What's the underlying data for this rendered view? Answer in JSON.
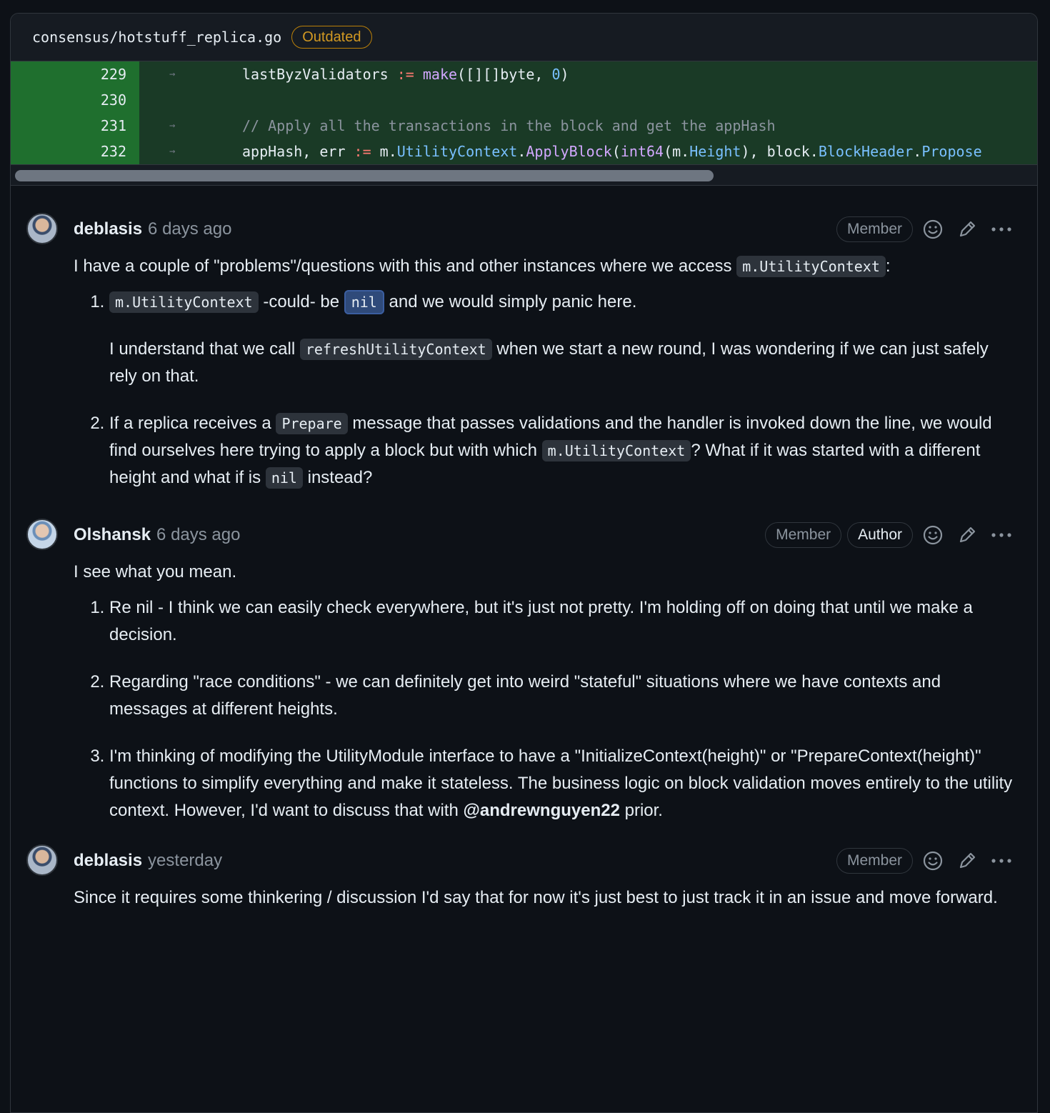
{
  "file": {
    "path": "consensus/hotstuff_replica.go",
    "badge": "Outdated"
  },
  "code_lines": [
    {
      "num": "229",
      "a": "lastByzValidators",
      "b": " := ",
      "c": "make",
      "d": "([][]byte, ",
      "e": "0",
      "f": ")"
    },
    {
      "num": "230"
    },
    {
      "num": "231",
      "comment": "// Apply all the transactions in the block and get the appHash"
    },
    {
      "num": "232",
      "p1": "appHash, err ",
      "p2": ":=",
      "p3": " m.",
      "p4": "UtilityContext",
      "p5": ".",
      "p6": "ApplyBlock",
      "p7": "(",
      "p8": "int64",
      "p9": "(m.",
      "p10": "Height",
      "p11": "), block.",
      "p12": "BlockHeader",
      "p13": ".",
      "p14": "Propose"
    }
  ],
  "comments": [
    {
      "author": "deblasis",
      "time": "6 days ago",
      "badges": [
        "Member"
      ],
      "intro_a": "I have a couple of \"problems\"/questions with this and other instances where we access ",
      "intro_code": "m.UtilityContext",
      "intro_b": ":",
      "item1_code1": "m.UtilityContext",
      "item1_a": " -could- be ",
      "item1_code2": "nil",
      "item1_b": " and we would simply panic here.",
      "item1_p_a": "I understand that we call ",
      "item1_p_code": "refreshUtilityContext",
      "item1_p_b": " when we start a new round, I was wondering if we can just safely rely on that.",
      "item2_a": "If a replica receives a ",
      "item2_code1": "Prepare",
      "item2_b": " message that passes validations and the handler is invoked down the line, we would find ourselves here trying to apply a block but with which ",
      "item2_code2": "m.UtilityContext",
      "item2_c": "? What if it was started with a different height and what if is ",
      "item2_code3": "nil",
      "item2_d": " instead?"
    },
    {
      "author": "Olshansk",
      "time": "6 days ago",
      "badges": [
        "Member",
        "Author"
      ],
      "intro": "I see what you mean.",
      "item1": "Re nil - I think we can easily check everywhere, but it's just not pretty. I'm holding off on doing that until we make a decision.",
      "item2": "Regarding \"race conditions\" - we can definitely get into weird \"stateful\" situations where we have contexts and messages at different heights.",
      "item3_a": "I'm thinking of modifying the UtilityModule interface to have a \"InitializeContext(height)\" or \"PrepareContext(height)\" functions to simplify everything and make it stateless. The business logic on block validation moves entirely to the utility context. However, I'd want to discuss that with ",
      "item3_mention": "@andrewnguyen22",
      "item3_b": " prior."
    },
    {
      "author": "deblasis",
      "time": "yesterday",
      "badges": [
        "Member"
      ],
      "body": "Since it requires some thinkering / discussion I'd say that for now it's just best to just track it in an issue and move forward."
    }
  ]
}
